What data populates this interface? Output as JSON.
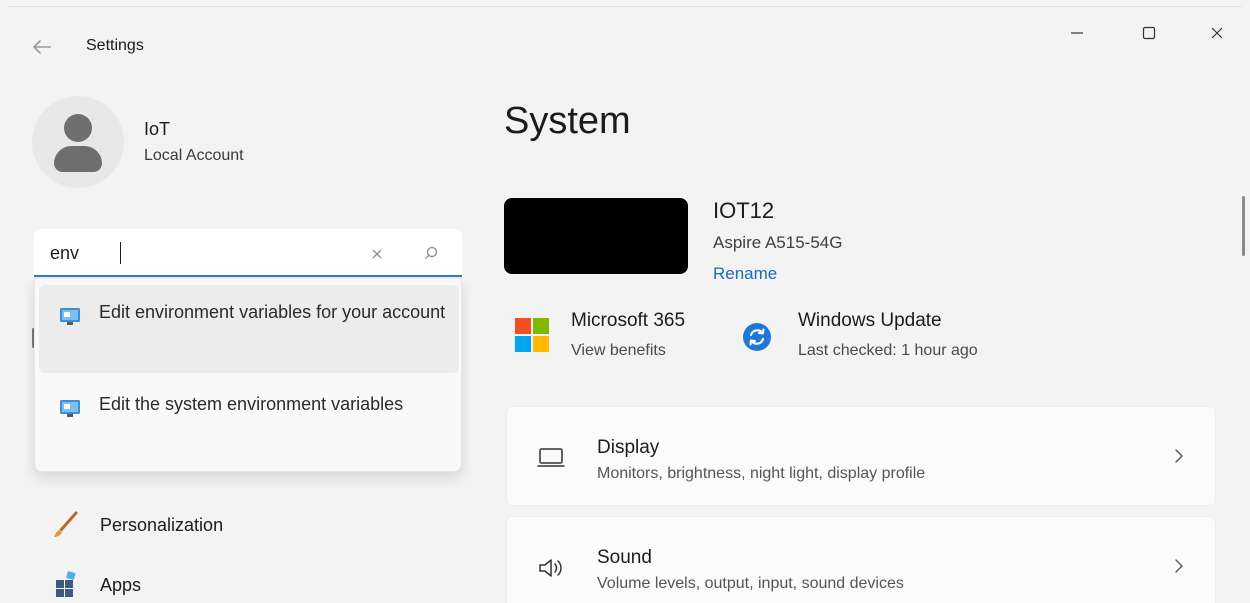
{
  "window": {
    "title": "Settings",
    "controls": {
      "minimize": "minimize-icon",
      "maximize": "maximize-icon",
      "close": "close-icon"
    }
  },
  "account": {
    "name": "IoT",
    "type": "Local Account"
  },
  "search": {
    "value": "env",
    "suggestions": [
      {
        "label": "Edit environment variables for your account",
        "icon": "control-panel-icon"
      },
      {
        "label": "Edit the system environment variables",
        "icon": "control-panel-icon"
      }
    ]
  },
  "nav": {
    "items": [
      {
        "label": "Personalization",
        "icon": "brush-icon"
      },
      {
        "label": "Apps",
        "icon": "apps-icon"
      }
    ]
  },
  "main": {
    "title": "System",
    "device": {
      "name": "IOT12",
      "model": "Aspire A515-54G",
      "rename": "Rename"
    },
    "tiles": [
      {
        "title": "Microsoft 365",
        "subtitle": "View benefits",
        "icon": "microsoft-logo-icon"
      },
      {
        "title": "Windows Update",
        "subtitle": "Last checked: 1 hour ago",
        "icon": "windows-update-icon"
      }
    ],
    "cards": [
      {
        "title": "Display",
        "description": "Monitors, brightness, night light, display profile",
        "icon": "monitor-icon"
      },
      {
        "title": "Sound",
        "description": "Volume levels, output, input, sound devices",
        "icon": "speaker-icon"
      }
    ]
  },
  "colors": {
    "accent": "#2e7dd4",
    "link": "#1a6bb8",
    "background": "#f3f3f3",
    "card": "#fbfbfb"
  }
}
